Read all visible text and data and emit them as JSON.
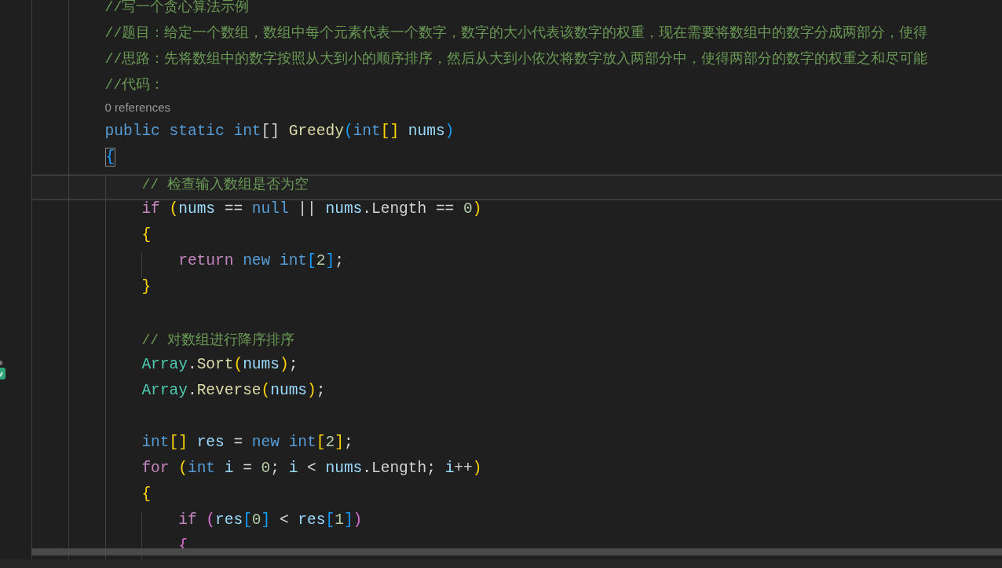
{
  "editor": {
    "lines": [
      {
        "current": false,
        "tokens": [
          {
            "text": "//写一个贪心算法示例",
            "kind": "comment"
          }
        ]
      },
      {
        "current": false,
        "tokens": [
          {
            "text": "//题目：给定一个数组，数组中每个元素代表一个数字，数字的大小代表该数字的权重，现在需要将数组中的数字分成两部分，使得",
            "kind": "comment"
          }
        ]
      },
      {
        "current": false,
        "tokens": [
          {
            "text": "//思路：先将数组中的数字按照从大到小的顺序排序，然后从大到小依次将数字放入两部分中，使得两部分的数字的权重之和尽可能",
            "kind": "comment"
          }
        ]
      },
      {
        "current": false,
        "tokens": [
          {
            "text": "//代码：",
            "kind": "comment"
          }
        ]
      },
      {
        "kind": "codelens",
        "text": "0 references"
      },
      {
        "current": false,
        "tokens": [
          {
            "text": "public static int",
            "kind": "keyword"
          },
          {
            "text": "[] ",
            "kind": "plain"
          },
          {
            "text": "Greedy",
            "kind": "function"
          },
          {
            "text": "(",
            "kind": "bracket-blue"
          },
          {
            "text": "int",
            "kind": "keyword"
          },
          {
            "text": "[]",
            "kind": "bracket-gold"
          },
          {
            "text": " nums",
            "kind": "variable"
          },
          {
            "text": ")",
            "kind": "bracket-blue"
          }
        ]
      },
      {
        "current": false,
        "tokens": [
          {
            "text": "{",
            "kind": "bracket-matched"
          }
        ],
        "children": [
          {
            "current": true,
            "tokens": [
              {
                "text": "// 检查输入数组是否为空",
                "kind": "comment"
              }
            ]
          },
          {
            "current": false,
            "tokens": [
              {
                "text": "if ",
                "kind": "control"
              },
              {
                "text": "(",
                "kind": "bracket-gold"
              },
              {
                "text": "nums",
                "kind": "variable"
              },
              {
                "text": " == ",
                "kind": "plain"
              },
              {
                "text": "null",
                "kind": "keyword"
              },
              {
                "text": " || ",
                "kind": "plain"
              },
              {
                "text": "nums",
                "kind": "variable"
              },
              {
                "text": ".Length == ",
                "kind": "plain"
              },
              {
                "text": "0",
                "kind": "number"
              },
              {
                "text": ")",
                "kind": "bracket-gold"
              }
            ]
          },
          {
            "current": false,
            "tokens": [
              {
                "text": "{",
                "kind": "bracket-gold"
              }
            ],
            "children": [
              {
                "current": false,
                "tokens": [
                  {
                    "text": "return ",
                    "kind": "control"
                  },
                  {
                    "text": "new int",
                    "kind": "keyword"
                  },
                  {
                    "text": "[",
                    "kind": "bracket-blue"
                  },
                  {
                    "text": "2",
                    "kind": "number"
                  },
                  {
                    "text": "]",
                    "kind": "bracket-blue"
                  },
                  {
                    "text": ";",
                    "kind": "plain"
                  }
                ]
              }
            ]
          },
          {
            "current": false,
            "tokens": [
              {
                "text": "}",
                "kind": "bracket-gold"
              }
            ]
          },
          {
            "current": false
          },
          {
            "current": false,
            "tokens": [
              {
                "text": "// 对数组进行降序排序",
                "kind": "comment"
              }
            ]
          },
          {
            "current": false,
            "tokens": [
              {
                "text": "Array",
                "kind": "type"
              },
              {
                "text": ".",
                "kind": "plain"
              },
              {
                "text": "Sort",
                "kind": "function"
              },
              {
                "text": "(",
                "kind": "bracket-gold"
              },
              {
                "text": "nums",
                "kind": "variable"
              },
              {
                "text": ")",
                "kind": "bracket-gold"
              },
              {
                "text": ";",
                "kind": "plain"
              }
            ]
          },
          {
            "current": false,
            "tokens": [
              {
                "text": "Array",
                "kind": "type"
              },
              {
                "text": ".",
                "kind": "plain"
              },
              {
                "text": "Reverse",
                "kind": "function"
              },
              {
                "text": "(",
                "kind": "bracket-gold"
              },
              {
                "text": "nums",
                "kind": "variable"
              },
              {
                "text": ")",
                "kind": "bracket-gold"
              },
              {
                "text": ";",
                "kind": "plain"
              }
            ]
          },
          {
            "current": false
          },
          {
            "current": false,
            "tokens": [
              {
                "text": "int",
                "kind": "keyword"
              },
              {
                "text": "[]",
                "kind": "bracket-gold"
              },
              {
                "text": " res",
                "kind": "variable"
              },
              {
                "text": " = ",
                "kind": "plain"
              },
              {
                "text": "new int",
                "kind": "keyword"
              },
              {
                "text": "[",
                "kind": "bracket-gold"
              },
              {
                "text": "2",
                "kind": "number"
              },
              {
                "text": "]",
                "kind": "bracket-gold"
              },
              {
                "text": ";",
                "kind": "plain"
              }
            ]
          },
          {
            "current": false,
            "tokens": [
              {
                "text": "for ",
                "kind": "control"
              },
              {
                "text": "(",
                "kind": "bracket-gold"
              },
              {
                "text": "int",
                "kind": "keyword"
              },
              {
                "text": " i",
                "kind": "variable"
              },
              {
                "text": " = ",
                "kind": "plain"
              },
              {
                "text": "0",
                "kind": "number"
              },
              {
                "text": "; ",
                "kind": "plain"
              },
              {
                "text": "i",
                "kind": "variable"
              },
              {
                "text": " < ",
                "kind": "plain"
              },
              {
                "text": "nums",
                "kind": "variable"
              },
              {
                "text": ".Length; ",
                "kind": "plain"
              },
              {
                "text": "i",
                "kind": "variable"
              },
              {
                "text": "++",
                "kind": "plain"
              },
              {
                "text": ")",
                "kind": "bracket-gold"
              }
            ]
          },
          {
            "current": false,
            "tokens": [
              {
                "text": "{",
                "kind": "bracket-gold"
              }
            ],
            "children": [
              {
                "current": false,
                "tokens": [
                  {
                    "text": "if ",
                    "kind": "control"
                  },
                  {
                    "text": "(",
                    "kind": "bracket-purple"
                  },
                  {
                    "text": "res",
                    "kind": "variable"
                  },
                  {
                    "text": "[",
                    "kind": "bracket-blue"
                  },
                  {
                    "text": "0",
                    "kind": "number"
                  },
                  {
                    "text": "]",
                    "kind": "bracket-blue"
                  },
                  {
                    "text": " < ",
                    "kind": "plain"
                  },
                  {
                    "text": "res",
                    "kind": "variable"
                  },
                  {
                    "text": "[",
                    "kind": "bracket-blue"
                  },
                  {
                    "text": "1",
                    "kind": "number"
                  },
                  {
                    "text": "]",
                    "kind": "bracket-blue"
                  },
                  {
                    "text": ")",
                    "kind": "bracket-purple"
                  }
                ]
              },
              {
                "current": false,
                "tokens": [
                  {
                    "text": "{",
                    "kind": "bracket-purple"
                  }
                ]
              }
            ]
          }
        ]
      }
    ]
  }
}
